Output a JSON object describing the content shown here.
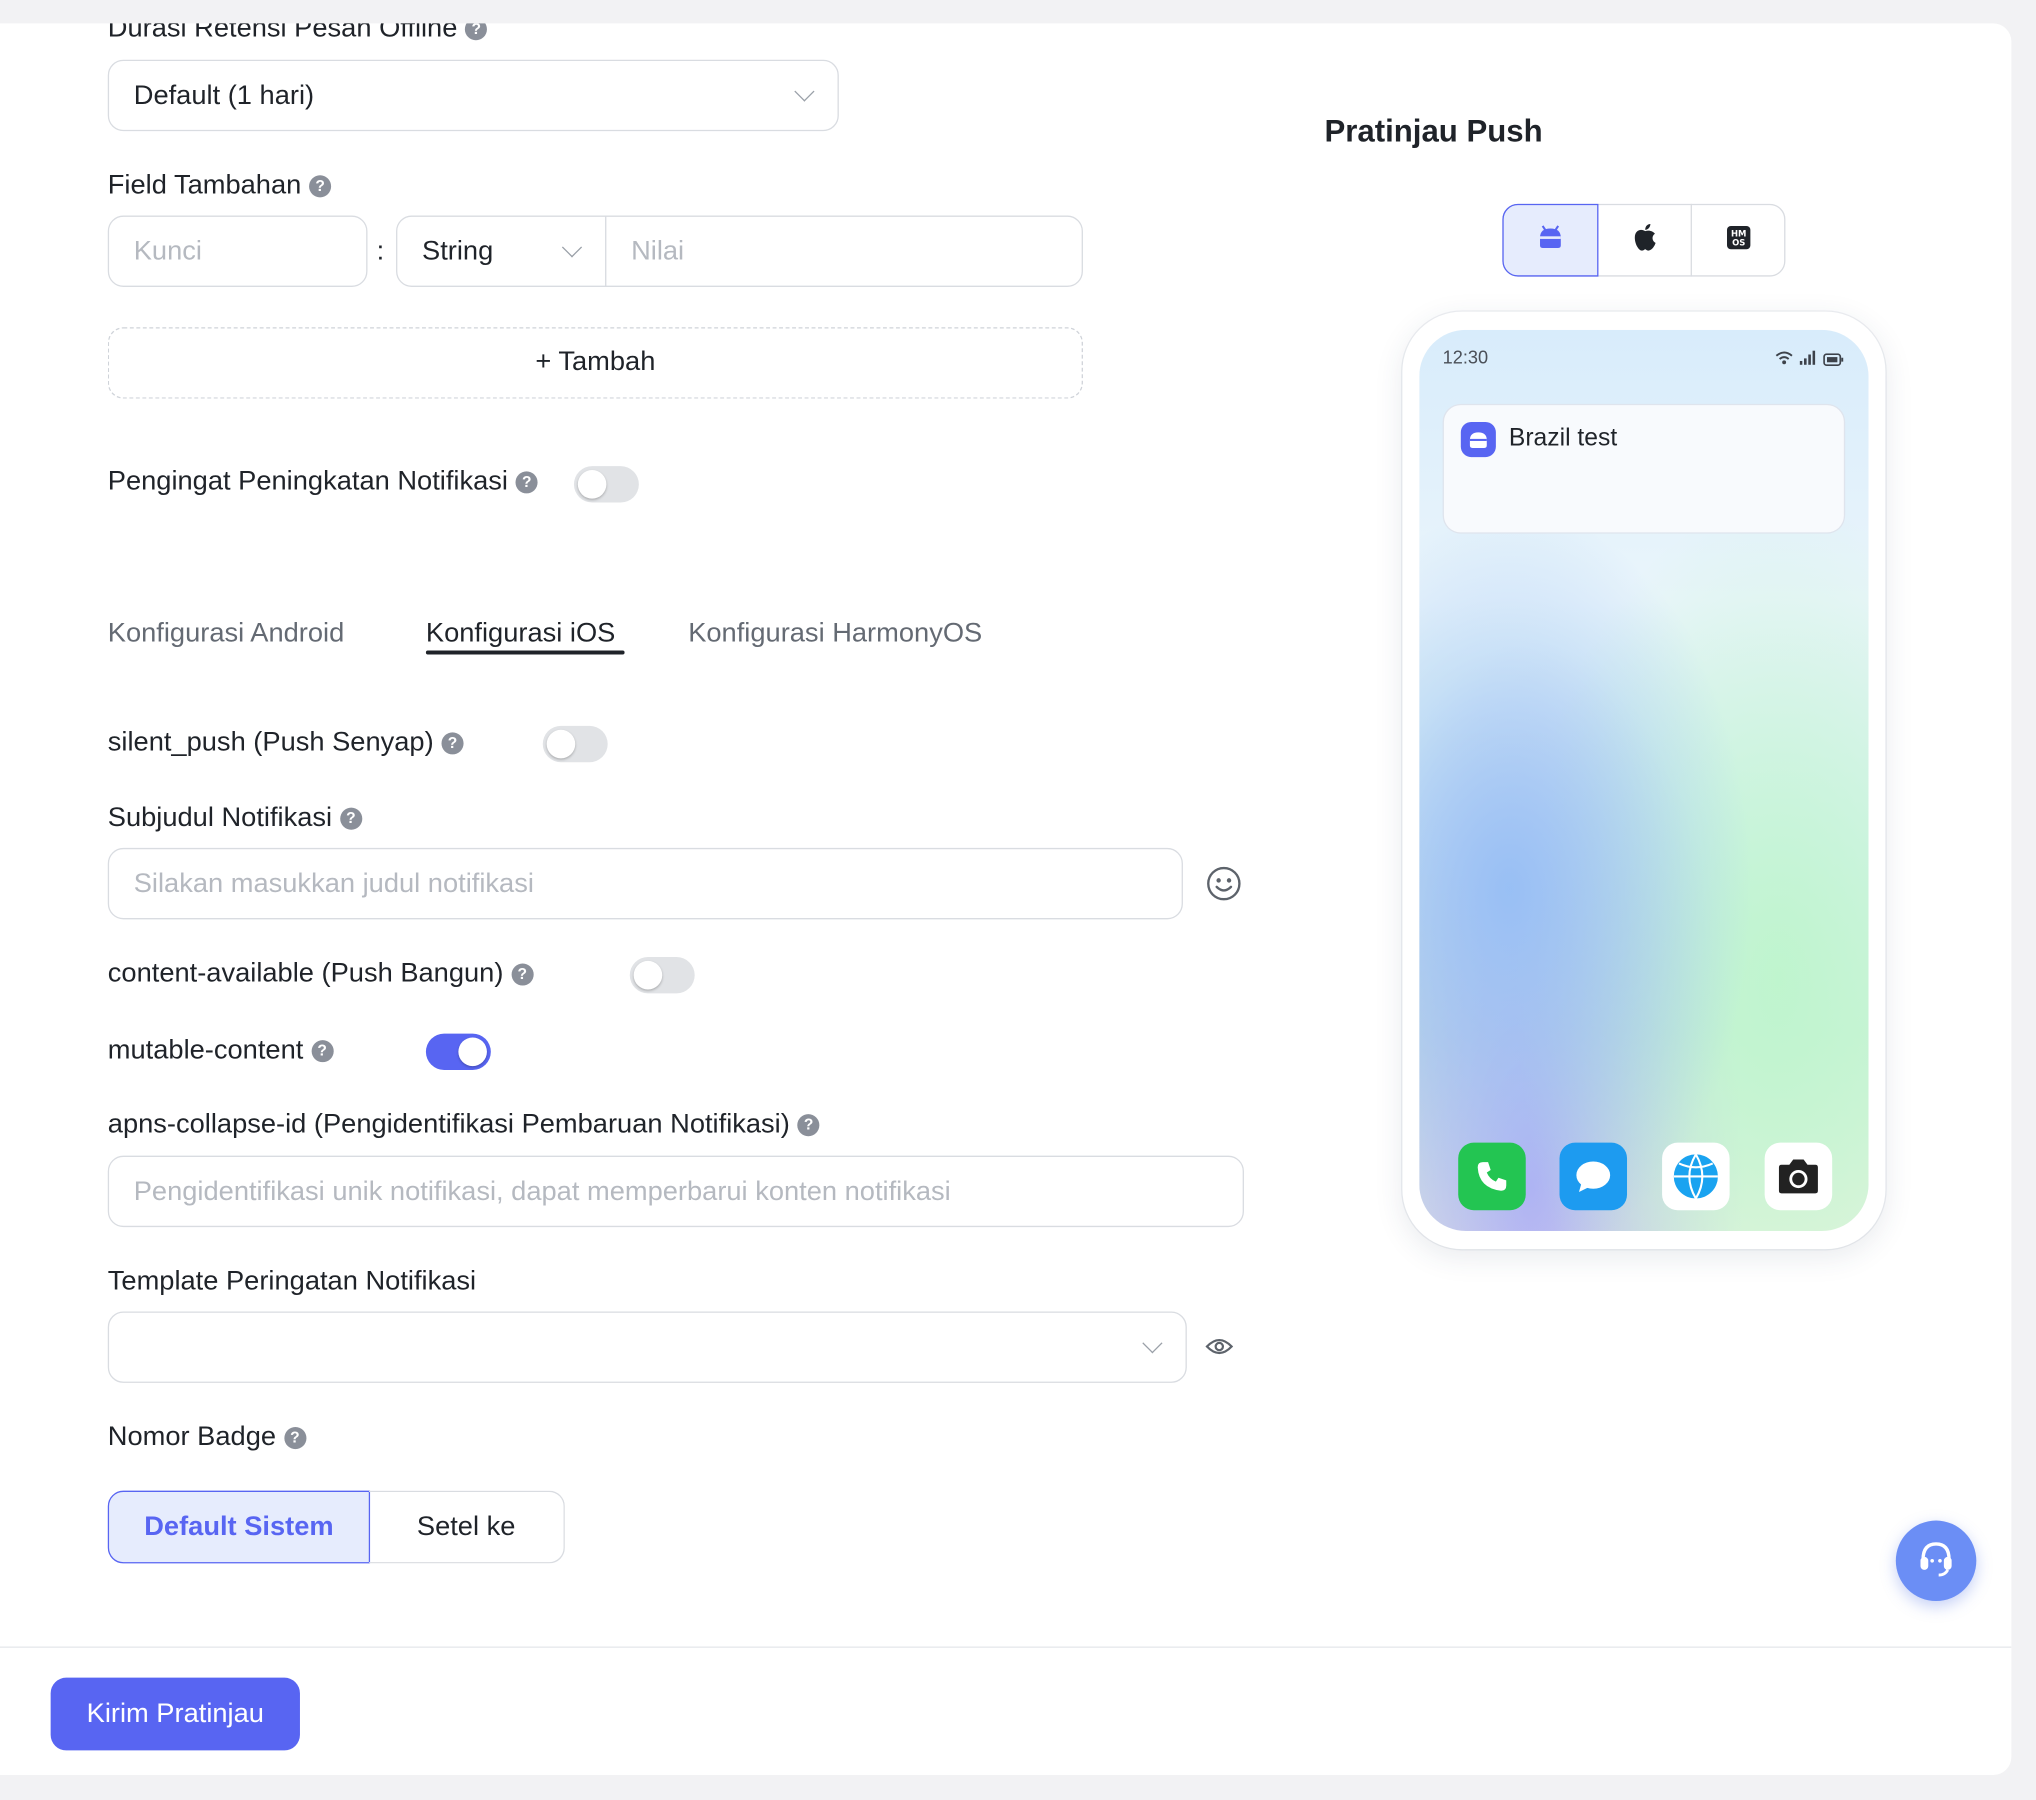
{
  "form": {
    "retention": {
      "label": "Durasi Retensi Pesan Offline",
      "value": "Default (1 hari)"
    },
    "extra_fields": {
      "label": "Field Tambahan",
      "key_placeholder": "Kunci",
      "separator": ":",
      "type_value": "String",
      "value_placeholder": "Nilai",
      "add_label": "+ Tambah"
    },
    "upgrade_reminder": {
      "label": "Pengingat Peningkatan Notifikasi",
      "enabled": false
    },
    "tabs": [
      {
        "label": "Konfigurasi Android",
        "active": false
      },
      {
        "label": "Konfigurasi iOS",
        "active": true
      },
      {
        "label": "Konfigurasi HarmonyOS",
        "active": false
      }
    ],
    "ios": {
      "silent_push": {
        "label": "silent_push (Push Senyap)",
        "enabled": false
      },
      "subtitle": {
        "label": "Subjudul Notifikasi",
        "placeholder": "Silakan masukkan judul notifikasi"
      },
      "content_available": {
        "label": "content-available (Push Bangun)",
        "enabled": false
      },
      "mutable_content": {
        "label": "mutable-content",
        "enabled": true
      },
      "collapse_id": {
        "label": "apns-collapse-id (Pengidentifikasi Pembaruan Notifikasi)",
        "placeholder": "Pengidentifikasi unik notifikasi, dapat memperbarui konten notifikasi"
      },
      "alert_template": {
        "label": "Template Peringatan Notifikasi",
        "value": ""
      },
      "badge": {
        "label": "Nomor Badge",
        "options": [
          "Default Sistem",
          "Setel ke"
        ],
        "selected": "Default Sistem"
      }
    }
  },
  "preview": {
    "title": "Pratinjau Push",
    "platforms": [
      {
        "icon": "android-icon",
        "selected": true
      },
      {
        "icon": "apple-icon",
        "selected": false
      },
      {
        "icon": "harmonyos-icon",
        "selected": false
      }
    ],
    "phone": {
      "time": "12:30",
      "notification_title": "Brazil test",
      "dock": [
        "phone-icon",
        "messages-icon",
        "browser-icon",
        "camera-icon"
      ]
    }
  },
  "footer": {
    "send_preview_label": "Kirim Pratinjau"
  },
  "colors": {
    "accent": "#5865f2",
    "accent_light": "#e6ecfd",
    "support_button": "#6b8ef5"
  }
}
